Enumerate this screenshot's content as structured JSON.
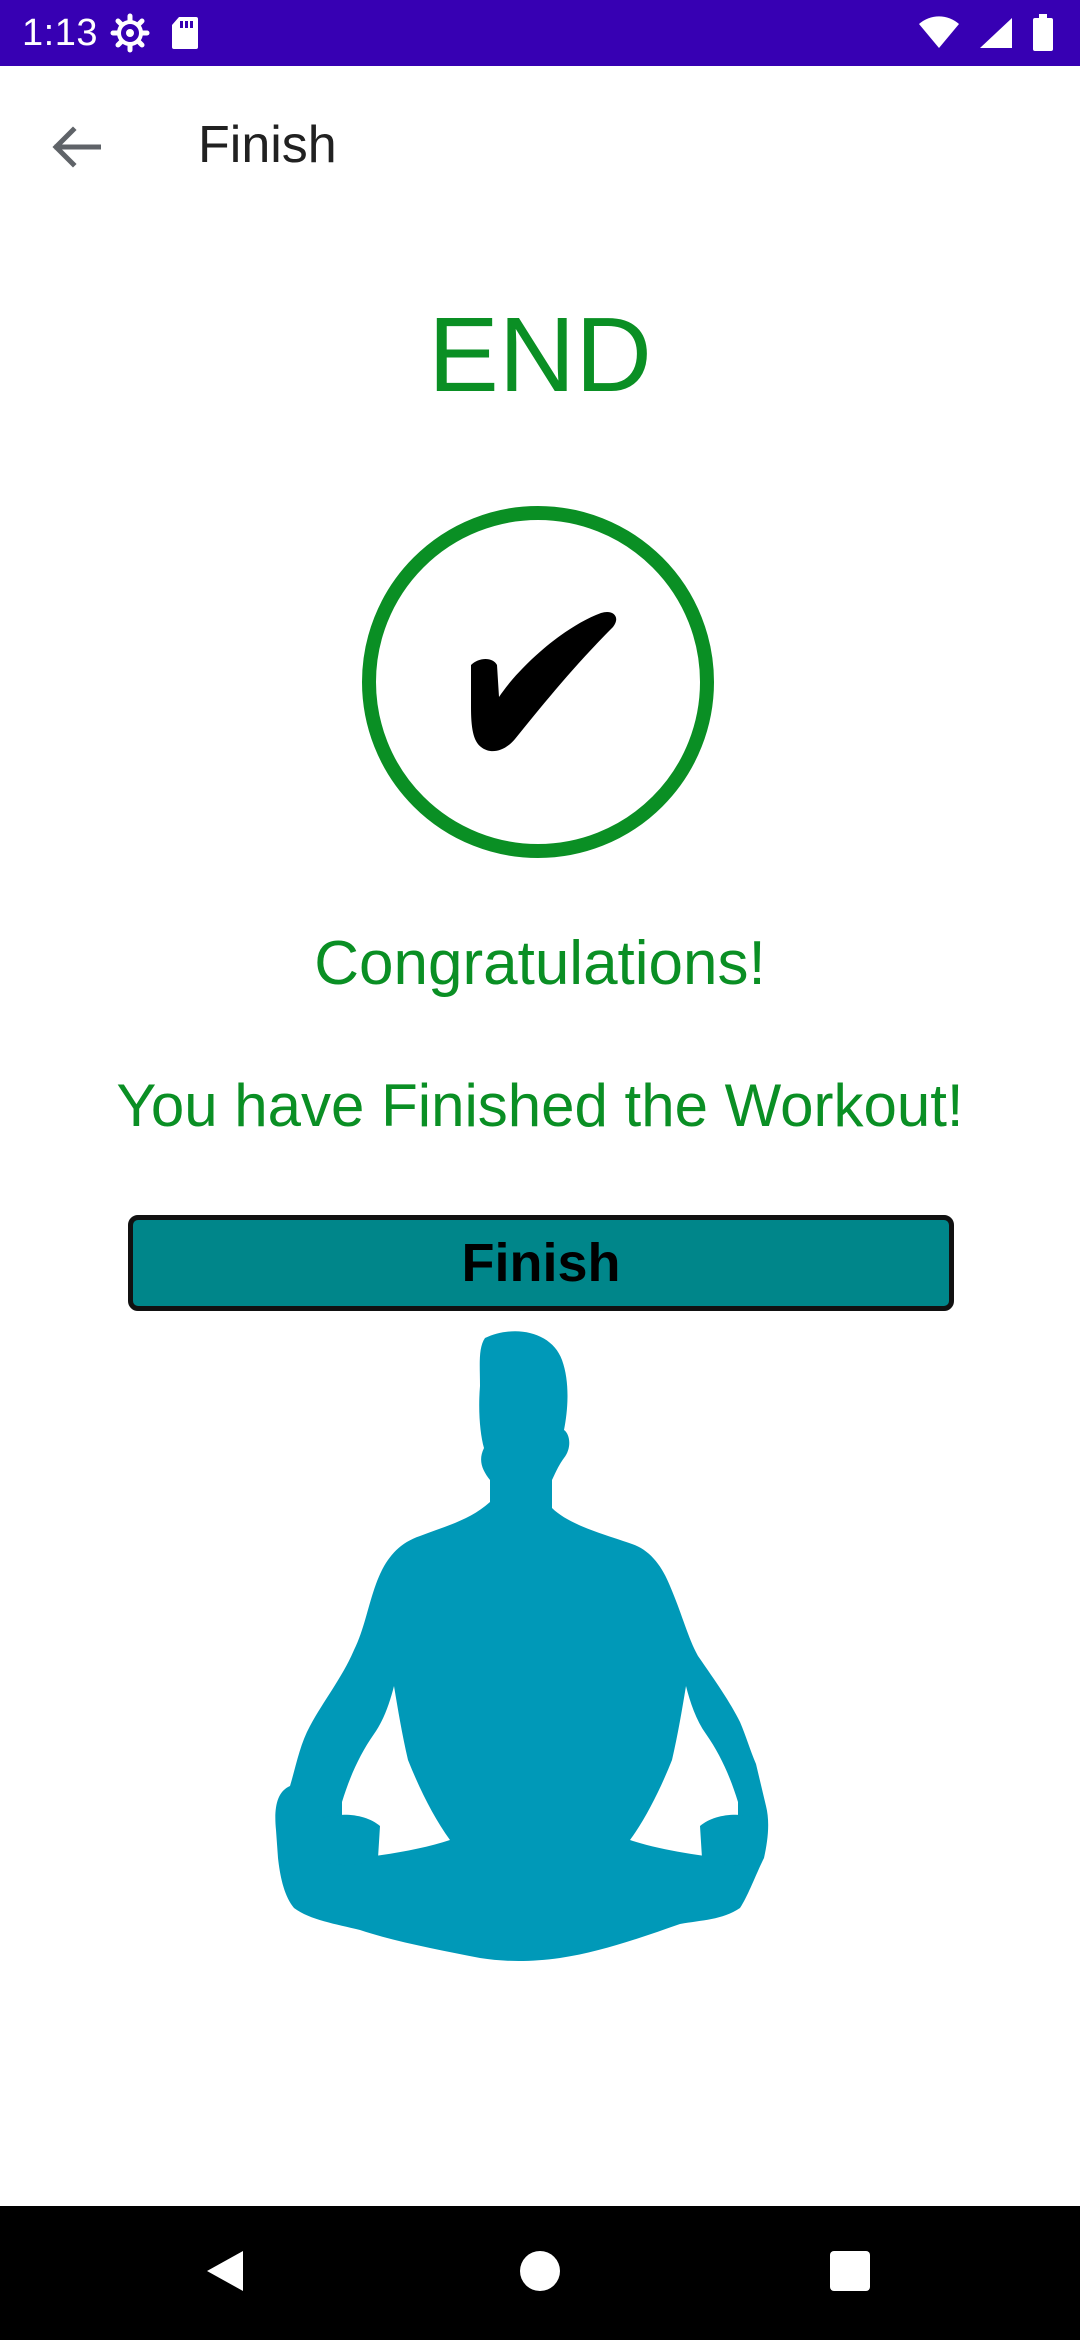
{
  "status_bar": {
    "time": "1:13",
    "icons_left": [
      "settings-gear-icon",
      "sd-card-icon"
    ],
    "icons_right": [
      "wifi-icon",
      "cell-signal-icon",
      "battery-icon"
    ],
    "background": "#3700b3"
  },
  "app_bar": {
    "back_icon": "arrow-back-icon",
    "title": "Finish"
  },
  "content": {
    "heading": "END",
    "check_icon": "checkmark-circle-icon",
    "congrats": "Congratulations!",
    "message": "You have Finished the Workout!",
    "finish_button_label": "Finish",
    "illustration": "meditation-pose-icon"
  },
  "nav_bar": {
    "icons": [
      "nav-back-icon",
      "nav-home-icon",
      "nav-recents-icon"
    ]
  },
  "colors": {
    "accent_green": "#0a8f24",
    "button_teal": "#00868a",
    "figure_blue": "#0099b8"
  }
}
